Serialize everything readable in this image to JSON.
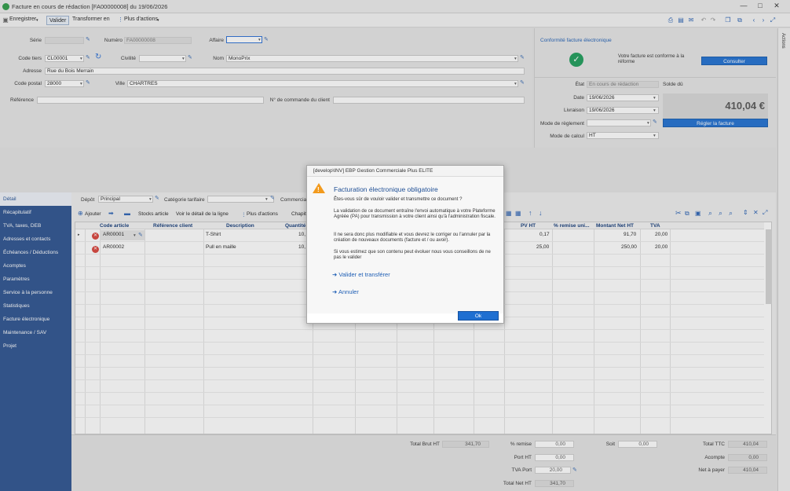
{
  "window": {
    "title": "Facture en cours de rédaction [FA00000008] du 19/06/2026",
    "controls": [
      "—",
      "□",
      "✕"
    ]
  },
  "toolbar": {
    "save_label": "Enregistrer",
    "validate_label": "Valider",
    "transform_label": "Transformer en",
    "more_actions_label": "Plus d'actions"
  },
  "form": {
    "serie_label": "Série",
    "serie_value": "",
    "numero_label": "Numéro",
    "numero_value": "FA00000008",
    "affaire_label": "Affaire",
    "affaire_value": "",
    "code_tiers_label": "Code tiers",
    "code_tiers_value": "CL00001",
    "civilite_label": "Civilité",
    "civilite_value": "",
    "nom_label": "Nom",
    "nom_value": "MonoPrix",
    "adresse_label": "Adresse",
    "adresse_value": "Rue du Bois Merrain",
    "code_postal_label": "Code postal",
    "code_postal_value": "28000",
    "ville_label": "Ville",
    "ville_value": "CHARTRES",
    "reference_label": "Référence",
    "reference_value": "",
    "commande_label": "N° de commande du client",
    "commande_value": ""
  },
  "conformity": {
    "title": "Conformité facture électronique",
    "message": "Votre facture est conforme à la réforme",
    "button": "Consulter"
  },
  "status": {
    "etat_label": "État",
    "etat_value": "En cours de rédaction",
    "solde_label": "Solde dû",
    "date_label": "Date",
    "date_value": "19/06/2026",
    "livraison_label": "Livraison",
    "livraison_value": "19/06/2026",
    "reglement_label": "Mode de règlement",
    "reglement_value": "",
    "calcul_label": "Mode de calcul",
    "calcul_value": "HT",
    "amount": "410,04 €",
    "pay_button": "Régler la facture"
  },
  "side_tab": "Actions",
  "nav": {
    "items": [
      {
        "label": "Détail"
      },
      {
        "label": "Récapitulatif"
      },
      {
        "label": "TVA, taxes, DEB"
      },
      {
        "label": "Adresses et contacts"
      },
      {
        "label": "Échéances / Déductions"
      },
      {
        "label": "Acomptes"
      },
      {
        "label": "Paramètres"
      },
      {
        "label": "Service à la personne"
      },
      {
        "label": "Statistiques"
      },
      {
        "label": "Facture électronique"
      },
      {
        "label": "Maintenance / SAV"
      },
      {
        "label": "Projet"
      }
    ]
  },
  "detail_bar": {
    "depot_label": "Dépôt",
    "depot_value": "Principal",
    "categorie_label": "Catégorie tarifaire",
    "categorie_value": "",
    "commercial_label": "Commercial"
  },
  "grid_toolbar": {
    "add_label": "Ajouter",
    "stocks_label": "Stocks article",
    "detail_label": "Voir le détail de la ligne",
    "more_label": "Plus d'actions",
    "chapitre_label": "Chapit"
  },
  "grid": {
    "columns": [
      "Code article",
      "Référence client",
      "Description",
      "Quantité",
      "PV HT",
      "% remise uni...",
      "Montant Net HT",
      "TVA"
    ],
    "rows": [
      {
        "code": "AR00001",
        "ref": "",
        "desc": "T-Shirt",
        "qty": "10,",
        "pv": "0,17",
        "remise": "",
        "montant": "91,70",
        "tva": "20,00"
      },
      {
        "code": "AR00002",
        "ref": "",
        "desc": "Pull en maille",
        "qty": "10,",
        "pv": "25,00",
        "remise": "",
        "montant": "250,00",
        "tva": "20,00"
      }
    ]
  },
  "totals": {
    "brut_label": "Total Brut HT",
    "brut_value": "341,70",
    "remise_label": "% remise",
    "remise_value": "0,00",
    "soit_label": "Soit",
    "soit_value": "0,00",
    "port_label": "Port HT",
    "port_value": "0,00",
    "tva_port_label": "TVA Port",
    "tva_port_value": "20,00",
    "net_ht_label": "Total Net HT",
    "net_ht_value": "341,70",
    "ttc_label": "Total TTC",
    "ttc_value": "410,04",
    "acompte_label": "Acompte",
    "acompte_value": "0,00",
    "net_payer_label": "Net à payer",
    "net_payer_value": "410,04"
  },
  "dialog": {
    "window_title": "[develop\\INV] EBP Gestion Commerciale Plus ELITE",
    "title": "Facturation électronique obligatoire",
    "question": "Êtes-vous sûr de vouloir valider et transmettre ce document ?",
    "para1": "La validation de ce document entraîne l'envoi automatique à votre Plateforme Agréée (PA) pour transmission à votre client ainsi qu'à l'administration fiscale.",
    "para2": "Il ne sera donc plus modifiable et vous devrez le corriger ou l'annuler par la création de nouveaux documents (facture et / ou avoir).",
    "para3": "Si vous estimez que son contenu peut évoluer nous vous conseillons de ne pas le valider",
    "validate_link": "Valider et transférer",
    "cancel_link": "Annuler",
    "ok_button": "Ok"
  }
}
